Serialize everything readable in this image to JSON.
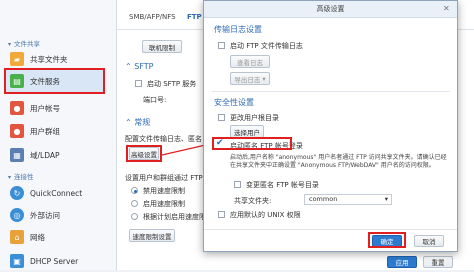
{
  "sidebar": {
    "file_sharing_cat": "文件共享",
    "connectivity_cat": "连接性",
    "items": [
      {
        "label": "共享文件夹",
        "icon": "shared-folder-icon",
        "color": "#f2a93b"
      },
      {
        "label": "文件服务",
        "icon": "file-services-icon",
        "color": "#4ab04a"
      },
      {
        "label": "用户帐号",
        "icon": "user-icon",
        "color": "#e2553f"
      },
      {
        "label": "用户群组",
        "icon": "group-icon",
        "color": "#e2553f"
      },
      {
        "label": "域/LDAP",
        "icon": "domain-ldap-icon",
        "color": "#5a7fb0"
      },
      {
        "label": "QuickConnect",
        "icon": "quickconnect-icon",
        "color": "#3a8fd6"
      },
      {
        "label": "外部访问",
        "icon": "external-access-icon",
        "color": "#3a8fd6"
      },
      {
        "label": "网络",
        "icon": "network-icon",
        "color": "#e9a23a"
      },
      {
        "label": "DHCP Server",
        "icon": "dhcp-icon",
        "color": "#3a8fd6"
      }
    ]
  },
  "main": {
    "tabs": [
      "SMB/AFP/NFS",
      "FTP"
    ],
    "speed_limit_btn": "联机限制",
    "sftp_section": "SFTP",
    "sftp_enable": "启动 SFTP 服务",
    "port_label": "端口号:",
    "general_section": "常规",
    "general_desc": "配置文件传输日志、匿名 FTP",
    "advanced_btn": "高级设置",
    "speed_desc": "设置用户和群组通过 FTP",
    "speed_options": [
      "禁用速度限制",
      "启用速度限制",
      "根据计划启用速度限制"
    ],
    "speed_settings_btn": "速度限制设置",
    "apply": "应用",
    "reset": "重置"
  },
  "dialog": {
    "title": "高级设置",
    "transfer_log_section": "传输日志设置",
    "enable_ftp_log": "启动 FTP 文件传输日志",
    "view_log_btn": "查看日志",
    "export_log_btn": "导出日志",
    "security_section": "安全性设置",
    "change_root": "更改用户根目录",
    "select_user_btn": "选择用户",
    "enable_anon": "启动匿名 FTP 帐号登录",
    "anon_desc": "启动后,用户名称 \"anonymous\" 用户名者通过 FTP 访问共享文件夹。请确认已经在共享文件夹中正确设置 \"Anonymous FTP/WebDAV\" 用户名的访问权限。",
    "change_anon_root": "变更匿名 FTP 帐号目录",
    "shared_folder_label": "共享文件夹:",
    "shared_folder_value": "common",
    "apply_unix": "应用默认的 UNIX 权限",
    "ok": "确定",
    "cancel": "取消"
  },
  "colors": {
    "accent": "#2d7bd0",
    "highlight": "#e02020"
  }
}
